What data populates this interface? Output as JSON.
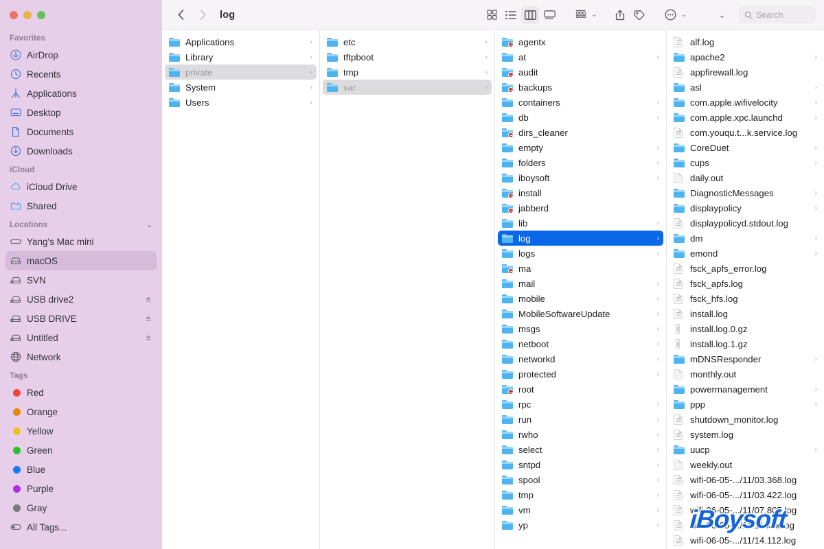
{
  "window": {
    "traffic_lights": [
      "close",
      "minimize",
      "maximize"
    ]
  },
  "toolbar": {
    "back_label": "‹",
    "forward_label": "›",
    "title": "log",
    "search_placeholder": "Search",
    "view_icons": [
      "grid-view-icon",
      "list-view-icon",
      "column-view-icon",
      "gallery-view-icon"
    ],
    "active_view": "column-view-icon",
    "action_icons": [
      "group-by-icon",
      "share-icon",
      "tag-icon",
      "more-icon",
      "chevron-down-icon",
      "search-icon"
    ]
  },
  "sidebar": {
    "sections": [
      {
        "title": "Favorites",
        "collapsible": false,
        "items": [
          {
            "label": "AirDrop",
            "icon": "airdrop-icon",
            "selected": false,
            "eject": false
          },
          {
            "label": "Recents",
            "icon": "clock-icon",
            "selected": false,
            "eject": false
          },
          {
            "label": "Applications",
            "icon": "applications-icon",
            "selected": false,
            "eject": false
          },
          {
            "label": "Desktop",
            "icon": "desktop-icon",
            "selected": false,
            "eject": false
          },
          {
            "label": "Documents",
            "icon": "document-icon",
            "selected": false,
            "eject": false
          },
          {
            "label": "Downloads",
            "icon": "downloads-icon",
            "selected": false,
            "eject": false
          }
        ]
      },
      {
        "title": "iCloud",
        "collapsible": false,
        "items": [
          {
            "label": "iCloud Drive",
            "icon": "cloud-icon",
            "selected": false,
            "eject": false
          },
          {
            "label": "Shared",
            "icon": "shared-folder-icon",
            "selected": false,
            "eject": false
          }
        ]
      },
      {
        "title": "Locations",
        "collapsible": true,
        "items": [
          {
            "label": "Yang's Mac mini",
            "icon": "mac-mini-icon",
            "selected": false,
            "eject": false
          },
          {
            "label": "macOS",
            "icon": "hard-drive-icon",
            "selected": true,
            "eject": false
          },
          {
            "label": "SVN",
            "icon": "external-drive-icon",
            "selected": false,
            "eject": false
          },
          {
            "label": "USB drive2",
            "icon": "external-drive-icon",
            "selected": false,
            "eject": true
          },
          {
            "label": "USB DRIVE",
            "icon": "external-drive-icon",
            "selected": false,
            "eject": true
          },
          {
            "label": "Untitled",
            "icon": "external-drive-icon",
            "selected": false,
            "eject": true
          },
          {
            "label": "Network",
            "icon": "network-icon",
            "selected": false,
            "eject": false
          }
        ]
      },
      {
        "title": "Tags",
        "collapsible": false,
        "items": [
          {
            "label": "Red",
            "icon": "tag-dot",
            "color": "#f2453d",
            "selected": false,
            "eject": false
          },
          {
            "label": "Orange",
            "icon": "tag-dot",
            "color": "#e28b08",
            "selected": false,
            "eject": false
          },
          {
            "label": "Yellow",
            "icon": "tag-dot",
            "color": "#eec020",
            "selected": false,
            "eject": false
          },
          {
            "label": "Green",
            "icon": "tag-dot",
            "color": "#28c22b",
            "selected": false,
            "eject": false
          },
          {
            "label": "Blue",
            "icon": "tag-dot",
            "color": "#1479f2",
            "selected": false,
            "eject": false
          },
          {
            "label": "Purple",
            "icon": "tag-dot",
            "color": "#ab31e0",
            "selected": false,
            "eject": false
          },
          {
            "label": "Gray",
            "icon": "tag-dot",
            "color": "#79787e",
            "selected": false,
            "eject": false
          },
          {
            "label": "All Tags...",
            "icon": "all-tags-icon",
            "color": "",
            "selected": false,
            "eject": false
          }
        ]
      }
    ]
  },
  "columns": [
    {
      "name": "column-1",
      "items": [
        {
          "label": "Applications",
          "type": "folder",
          "locked": false,
          "chevron": true,
          "selected": "none"
        },
        {
          "label": "Library",
          "type": "folder",
          "locked": false,
          "chevron": true,
          "selected": "none"
        },
        {
          "label": "private",
          "type": "folder",
          "locked": false,
          "chevron": true,
          "selected": "inactive"
        },
        {
          "label": "System",
          "type": "folder",
          "locked": false,
          "chevron": true,
          "selected": "none"
        },
        {
          "label": "Users",
          "type": "folder",
          "locked": false,
          "chevron": true,
          "selected": "none"
        }
      ]
    },
    {
      "name": "column-2",
      "items": [
        {
          "label": "etc",
          "type": "folder",
          "locked": false,
          "chevron": true,
          "selected": "none"
        },
        {
          "label": "tftpboot",
          "type": "folder",
          "locked": false,
          "chevron": true,
          "selected": "none"
        },
        {
          "label": "tmp",
          "type": "folder",
          "locked": false,
          "chevron": true,
          "selected": "none"
        },
        {
          "label": "var",
          "type": "folder",
          "locked": false,
          "chevron": true,
          "selected": "inactive"
        }
      ]
    },
    {
      "name": "column-3",
      "items": [
        {
          "label": "agentx",
          "type": "folder",
          "locked": true,
          "chevron": false,
          "selected": "none"
        },
        {
          "label": "at",
          "type": "folder",
          "locked": false,
          "chevron": true,
          "selected": "none"
        },
        {
          "label": "audit",
          "type": "folder",
          "locked": true,
          "chevron": false,
          "selected": "none"
        },
        {
          "label": "backups",
          "type": "folder",
          "locked": true,
          "chevron": false,
          "selected": "none"
        },
        {
          "label": "containers",
          "type": "folder",
          "locked": false,
          "chevron": true,
          "selected": "none"
        },
        {
          "label": "db",
          "type": "folder",
          "locked": false,
          "chevron": true,
          "selected": "none"
        },
        {
          "label": "dirs_cleaner",
          "type": "folder",
          "locked": true,
          "chevron": false,
          "selected": "none"
        },
        {
          "label": "empty",
          "type": "folder",
          "locked": false,
          "chevron": true,
          "selected": "none"
        },
        {
          "label": "folders",
          "type": "folder",
          "locked": false,
          "chevron": true,
          "selected": "none"
        },
        {
          "label": "iboysoft",
          "type": "folder",
          "locked": false,
          "chevron": true,
          "selected": "none"
        },
        {
          "label": "install",
          "type": "folder",
          "locked": true,
          "chevron": false,
          "selected": "none"
        },
        {
          "label": "jabberd",
          "type": "folder",
          "locked": true,
          "chevron": false,
          "selected": "none"
        },
        {
          "label": "lib",
          "type": "folder",
          "locked": false,
          "chevron": true,
          "selected": "none"
        },
        {
          "label": "log",
          "type": "folder",
          "locked": false,
          "chevron": true,
          "selected": "active"
        },
        {
          "label": "logs",
          "type": "folder",
          "locked": false,
          "chevron": true,
          "selected": "none"
        },
        {
          "label": "ma",
          "type": "folder",
          "locked": true,
          "chevron": false,
          "selected": "none"
        },
        {
          "label": "mail",
          "type": "folder",
          "locked": false,
          "chevron": true,
          "selected": "none"
        },
        {
          "label": "mobile",
          "type": "folder",
          "locked": false,
          "chevron": true,
          "selected": "none"
        },
        {
          "label": "MobileSoftwareUpdate",
          "type": "folder",
          "locked": false,
          "chevron": true,
          "selected": "none"
        },
        {
          "label": "msgs",
          "type": "folder",
          "locked": false,
          "chevron": true,
          "selected": "none"
        },
        {
          "label": "netboot",
          "type": "folder",
          "locked": false,
          "chevron": true,
          "selected": "none"
        },
        {
          "label": "networkd",
          "type": "folder",
          "locked": false,
          "chevron": true,
          "selected": "none"
        },
        {
          "label": "protected",
          "type": "folder",
          "locked": false,
          "chevron": true,
          "selected": "none"
        },
        {
          "label": "root",
          "type": "folder",
          "locked": true,
          "chevron": false,
          "selected": "none"
        },
        {
          "label": "rpc",
          "type": "folder",
          "locked": false,
          "chevron": true,
          "selected": "none"
        },
        {
          "label": "run",
          "type": "folder",
          "locked": false,
          "chevron": true,
          "selected": "none"
        },
        {
          "label": "rwho",
          "type": "folder",
          "locked": false,
          "chevron": true,
          "selected": "none"
        },
        {
          "label": "select",
          "type": "folder",
          "locked": false,
          "chevron": true,
          "selected": "none"
        },
        {
          "label": "sntpd",
          "type": "folder",
          "locked": false,
          "chevron": true,
          "selected": "none"
        },
        {
          "label": "spool",
          "type": "folder",
          "locked": false,
          "chevron": true,
          "selected": "none"
        },
        {
          "label": "tmp",
          "type": "folder",
          "locked": false,
          "chevron": true,
          "selected": "none"
        },
        {
          "label": "vm",
          "type": "folder",
          "locked": false,
          "chevron": true,
          "selected": "none"
        },
        {
          "label": "yp",
          "type": "folder",
          "locked": false,
          "chevron": true,
          "selected": "none"
        }
      ]
    },
    {
      "name": "column-4",
      "items": [
        {
          "label": "alf.log",
          "type": "file-lined",
          "locked": false,
          "chevron": false,
          "selected": "none"
        },
        {
          "label": "apache2",
          "type": "folder",
          "locked": false,
          "chevron": true,
          "selected": "none"
        },
        {
          "label": "appfirewall.log",
          "type": "file-lined",
          "locked": false,
          "chevron": false,
          "selected": "none"
        },
        {
          "label": "asl",
          "type": "folder",
          "locked": false,
          "chevron": true,
          "selected": "none"
        },
        {
          "label": "com.apple.wifivelocity",
          "type": "folder",
          "locked": false,
          "chevron": true,
          "selected": "none"
        },
        {
          "label": "com.apple.xpc.launchd",
          "type": "folder",
          "locked": false,
          "chevron": true,
          "selected": "none"
        },
        {
          "label": "com.youqu.t...k.service.log",
          "type": "file-lined",
          "locked": false,
          "chevron": false,
          "selected": "none"
        },
        {
          "label": "CoreDuet",
          "type": "folder",
          "locked": false,
          "chevron": true,
          "selected": "none"
        },
        {
          "label": "cups",
          "type": "folder",
          "locked": false,
          "chevron": true,
          "selected": "none"
        },
        {
          "label": "daily.out",
          "type": "file-plain",
          "locked": false,
          "chevron": false,
          "selected": "none"
        },
        {
          "label": "DiagnosticMessages",
          "type": "folder",
          "locked": false,
          "chevron": true,
          "selected": "none"
        },
        {
          "label": "displaypolicy",
          "type": "folder",
          "locked": false,
          "chevron": true,
          "selected": "none"
        },
        {
          "label": "displaypolicyd.stdout.log",
          "type": "file-lined",
          "locked": false,
          "chevron": false,
          "selected": "none"
        },
        {
          "label": "dm",
          "type": "folder",
          "locked": false,
          "chevron": true,
          "selected": "none"
        },
        {
          "label": "emond",
          "type": "folder",
          "locked": false,
          "chevron": true,
          "selected": "none"
        },
        {
          "label": "fsck_apfs_error.log",
          "type": "file-lined",
          "locked": false,
          "chevron": false,
          "selected": "none"
        },
        {
          "label": "fsck_apfs.log",
          "type": "file-lined",
          "locked": false,
          "chevron": false,
          "selected": "none"
        },
        {
          "label": "fsck_hfs.log",
          "type": "file-lined",
          "locked": false,
          "chevron": false,
          "selected": "none"
        },
        {
          "label": "install.log",
          "type": "file-lined",
          "locked": false,
          "chevron": false,
          "selected": "none"
        },
        {
          "label": "install.log.0.gz",
          "type": "file-gz",
          "locked": false,
          "chevron": false,
          "selected": "none"
        },
        {
          "label": "install.log.1.gz",
          "type": "file-gz",
          "locked": false,
          "chevron": false,
          "selected": "none"
        },
        {
          "label": "mDNSResponder",
          "type": "folder",
          "locked": false,
          "chevron": true,
          "selected": "none"
        },
        {
          "label": "monthly.out",
          "type": "file-plain",
          "locked": false,
          "chevron": false,
          "selected": "none"
        },
        {
          "label": "powermanagement",
          "type": "folder",
          "locked": false,
          "chevron": true,
          "selected": "none"
        },
        {
          "label": "ppp",
          "type": "folder",
          "locked": false,
          "chevron": true,
          "selected": "none"
        },
        {
          "label": "shutdown_monitor.log",
          "type": "file-lined",
          "locked": false,
          "chevron": false,
          "selected": "none"
        },
        {
          "label": "system.log",
          "type": "file-lined",
          "locked": false,
          "chevron": false,
          "selected": "none"
        },
        {
          "label": "uucp",
          "type": "folder",
          "locked": false,
          "chevron": true,
          "selected": "none"
        },
        {
          "label": "weekly.out",
          "type": "file-plain",
          "locked": false,
          "chevron": false,
          "selected": "none"
        },
        {
          "label": "wifi-06-05-.../11/03.368.log",
          "type": "file-lined",
          "locked": false,
          "chevron": false,
          "selected": "none"
        },
        {
          "label": "wifi-06-05-.../11/03.422.log",
          "type": "file-lined",
          "locked": false,
          "chevron": false,
          "selected": "none"
        },
        {
          "label": "wifi-06-05-.../11/07.805.log",
          "type": "file-lined",
          "locked": false,
          "chevron": false,
          "selected": "none"
        },
        {
          "label": "wifi-06-05-.../11/11.xxx.log",
          "type": "file-lined",
          "locked": false,
          "chevron": false,
          "selected": "none"
        },
        {
          "label": "wifi-06-05-.../11/14.112.log",
          "type": "file-lined",
          "locked": false,
          "chevron": false,
          "selected": "none"
        }
      ]
    }
  ],
  "watermark": {
    "text": "iBoysoft",
    "color": "#1565d8"
  }
}
